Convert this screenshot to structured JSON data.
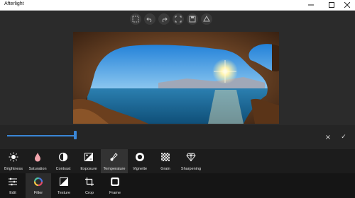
{
  "app": {
    "title": "Afterlight"
  },
  "window_controls": [
    "minimize-icon",
    "maximize-icon",
    "close-icon"
  ],
  "toolbar": [
    "frame-toggle-icon",
    "undo-icon",
    "redo-icon",
    "fullscreen-icon",
    "save-icon",
    "share-icon"
  ],
  "photo": {
    "description_icon": "photo-preview"
  },
  "slider": {
    "value_fraction": 0.22,
    "accent": "#3a86d6"
  },
  "actions": {
    "cancel": "×",
    "apply": "✓"
  },
  "tools": [
    {
      "label": "Brightness",
      "icon": "sun-icon"
    },
    {
      "label": "Saturation",
      "icon": "drop-icon"
    },
    {
      "label": "Contrast",
      "icon": "contrast-icon"
    },
    {
      "label": "Exposure",
      "icon": "exposure-icon"
    },
    {
      "label": "Temperature",
      "icon": "thermometer-icon"
    },
    {
      "label": "Vignette",
      "icon": "vignette-icon"
    },
    {
      "label": "Grain",
      "icon": "grain-icon"
    },
    {
      "label": "Sharpening",
      "icon": "diamond-icon"
    }
  ],
  "selected_tool": "Temperature",
  "categories": [
    {
      "label": "Edit",
      "icon": "sliders-icon"
    },
    {
      "label": "Filter",
      "icon": "filter-ring-icon"
    },
    {
      "label": "Texture",
      "icon": "texture-icon"
    },
    {
      "label": "Crop",
      "icon": "crop-icon"
    },
    {
      "label": "Frame",
      "icon": "frame-icon"
    }
  ],
  "selected_category": "Filter"
}
